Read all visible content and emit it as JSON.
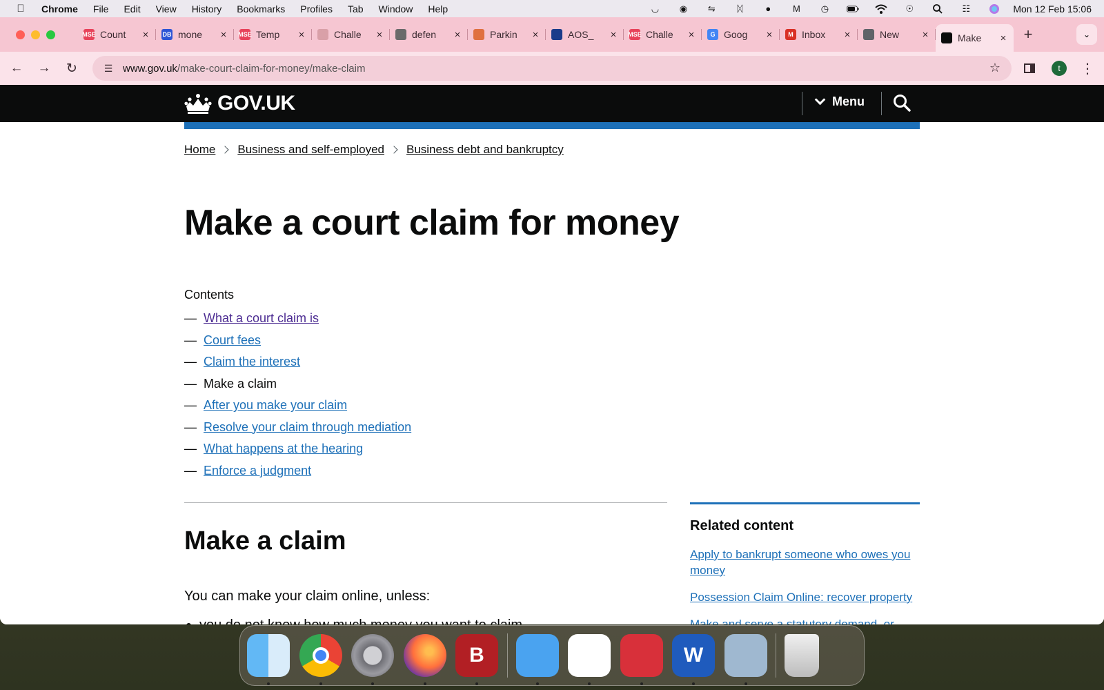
{
  "menubar": {
    "app": "Chrome",
    "items": [
      "File",
      "Edit",
      "View",
      "History",
      "Bookmarks",
      "Profiles",
      "Tab",
      "Window",
      "Help"
    ],
    "clock": "Mon 12 Feb  15:06"
  },
  "tabs": [
    {
      "title": "Count",
      "favicon_color": "#e8425a",
      "favicon_text": "MSE"
    },
    {
      "title": "mone",
      "favicon_color": "#2d55d6",
      "favicon_text": "DB"
    },
    {
      "title": "Temp",
      "favicon_color": "#e8425a",
      "favicon_text": "MSE"
    },
    {
      "title": "Challe",
      "favicon_color": "#d9a0a8",
      "favicon_text": ""
    },
    {
      "title": "defen",
      "favicon_color": "#6a6a6a",
      "favicon_text": ""
    },
    {
      "title": "Parkin",
      "favicon_color": "#e07040",
      "favicon_text": ""
    },
    {
      "title": "AOS_",
      "favicon_color": "#1a3b8a",
      "favicon_text": ""
    },
    {
      "title": "Challe",
      "favicon_color": "#e8425a",
      "favicon_text": "MSE"
    },
    {
      "title": "Goog",
      "favicon_color": "#4285f4",
      "favicon_text": "G"
    },
    {
      "title": "Inbox",
      "favicon_color": "#d93025",
      "favicon_text": "M"
    },
    {
      "title": "New",
      "favicon_color": "#5f6368",
      "favicon_text": ""
    },
    {
      "title": "Make",
      "favicon_color": "#0b0c0c",
      "favicon_text": "",
      "active": true
    }
  ],
  "omnibox": {
    "domain": "www.gov.uk",
    "path": "/make-court-claim-for-money/make-claim"
  },
  "profile_initial": "t",
  "gov": {
    "logo": "GOV.UK",
    "menu_label": "Menu"
  },
  "breadcrumb": [
    "Home",
    "Business and self-employed",
    "Business debt and bankruptcy"
  ],
  "page_title": "Make a court claim for money",
  "contents_label": "Contents",
  "contents": [
    {
      "label": "What a court claim is",
      "state": "visited"
    },
    {
      "label": "Court fees",
      "state": "link"
    },
    {
      "label": "Claim the interest",
      "state": "link"
    },
    {
      "label": "Make a claim",
      "state": "current"
    },
    {
      "label": "After you make your claim",
      "state": "link"
    },
    {
      "label": "Resolve your claim through mediation",
      "state": "link"
    },
    {
      "label": "What happens at the hearing",
      "state": "link"
    },
    {
      "label": "Enforce a judgment",
      "state": "link"
    }
  ],
  "section": {
    "title": "Make a claim",
    "intro": "You can make your claim online, unless:",
    "bullet_1": "you do not know how much money you want to claim"
  },
  "related": {
    "title": "Related content",
    "links": [
      "Apply to bankrupt someone who owes you money",
      "Possession Claim Online: recover property",
      "Make and serve a statutory demand, or"
    ]
  },
  "dock": [
    {
      "name": "finder",
      "color": "#3b8fe8"
    },
    {
      "name": "chrome",
      "color": "#ffffff"
    },
    {
      "name": "system-settings",
      "color": "#8e8e93"
    },
    {
      "name": "firefox",
      "color": "#5b2fb0"
    },
    {
      "name": "bitwarden",
      "color": "#b21f24",
      "label": "B"
    },
    {
      "name": "mail",
      "color": "#4aa3f0"
    },
    {
      "name": "nordvpn",
      "color": "#ffffff"
    },
    {
      "name": "expressvpn",
      "color": "#d8303a"
    },
    {
      "name": "word",
      "color": "#1f5bbd",
      "label": "W"
    },
    {
      "name": "preview",
      "color": "#9fb8d0"
    },
    {
      "name": "trash",
      "color": "#d8d8d8"
    }
  ],
  "colors": {
    "gov_black": "#0b0c0c",
    "gov_blue": "#1d70b8",
    "link_visited": "#4c2c92",
    "tabbar_pink": "#f6c6d2"
  }
}
